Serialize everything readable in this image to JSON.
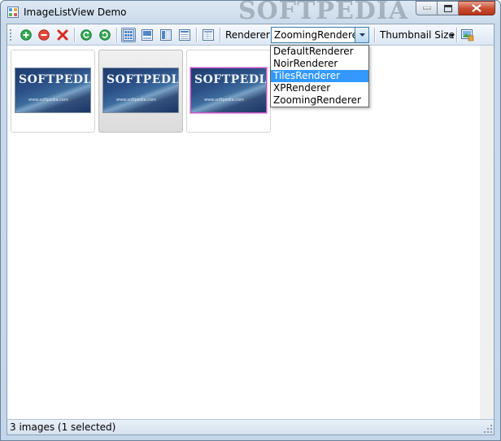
{
  "window": {
    "title": "ImageListView Demo",
    "watermark": "SOFTPEDIA"
  },
  "toolbar": {
    "buttons": [
      {
        "name": "add-icon",
        "color": "#2f9e3a"
      },
      {
        "name": "remove-icon",
        "color": "#d23a2a"
      },
      {
        "name": "clear-icon",
        "color": "#cc2a1c"
      },
      {
        "name": "rotate-left-icon",
        "color": "#2f9e3a"
      },
      {
        "name": "rotate-right-icon",
        "color": "#2f9e3a"
      },
      {
        "name": "thumbnails-view-icon",
        "active": true
      },
      {
        "name": "gallery-view-icon"
      },
      {
        "name": "pane-view-icon"
      },
      {
        "name": "details-view-icon"
      },
      {
        "name": "columns-icon"
      }
    ],
    "renderer_label": "Renderer:",
    "renderer_value": "ZoomingRenderer",
    "thumbnail_size_label": "Thumbnail Size",
    "image_icon": "image-settings-icon"
  },
  "renderer_options": [
    {
      "label": "DefaultRenderer",
      "highlighted": false
    },
    {
      "label": "NoirRenderer",
      "highlighted": false
    },
    {
      "label": "TilesRenderer",
      "highlighted": true
    },
    {
      "label": "XPRenderer",
      "highlighted": false
    },
    {
      "label": "ZoomingRenderer",
      "highlighted": false
    }
  ],
  "thumbnails": [
    {
      "brand": "SOFTPEDIA",
      "url": "www.softpedia.com",
      "selected": false,
      "border": "normal"
    },
    {
      "brand": "SOFTPEDIA",
      "url": "www.softpedia.com",
      "selected": true,
      "border": "normal"
    },
    {
      "brand": "SOFTPEDIA",
      "url": "www.softpedia.com",
      "selected": false,
      "border": "purple"
    }
  ],
  "status": {
    "text": "3 images (1 selected)"
  }
}
